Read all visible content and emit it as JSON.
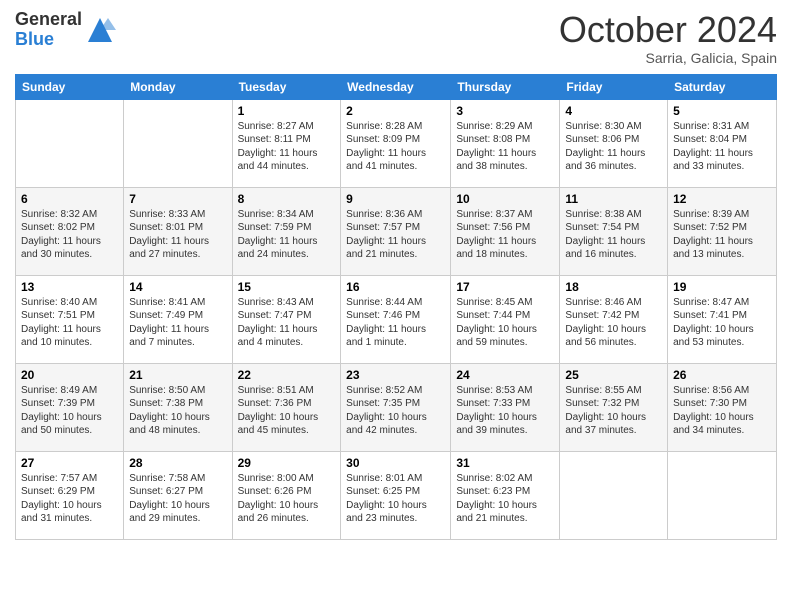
{
  "header": {
    "logo_general": "General",
    "logo_blue": "Blue",
    "month_title": "October 2024",
    "subtitle": "Sarria, Galicia, Spain"
  },
  "days_of_week": [
    "Sunday",
    "Monday",
    "Tuesday",
    "Wednesday",
    "Thursday",
    "Friday",
    "Saturday"
  ],
  "weeks": [
    [
      null,
      null,
      {
        "day": "1",
        "sunrise": "Sunrise: 8:27 AM",
        "sunset": "Sunset: 8:11 PM",
        "daylight": "Daylight: 11 hours and 44 minutes."
      },
      {
        "day": "2",
        "sunrise": "Sunrise: 8:28 AM",
        "sunset": "Sunset: 8:09 PM",
        "daylight": "Daylight: 11 hours and 41 minutes."
      },
      {
        "day": "3",
        "sunrise": "Sunrise: 8:29 AM",
        "sunset": "Sunset: 8:08 PM",
        "daylight": "Daylight: 11 hours and 38 minutes."
      },
      {
        "day": "4",
        "sunrise": "Sunrise: 8:30 AM",
        "sunset": "Sunset: 8:06 PM",
        "daylight": "Daylight: 11 hours and 36 minutes."
      },
      {
        "day": "5",
        "sunrise": "Sunrise: 8:31 AM",
        "sunset": "Sunset: 8:04 PM",
        "daylight": "Daylight: 11 hours and 33 minutes."
      }
    ],
    [
      {
        "day": "6",
        "sunrise": "Sunrise: 8:32 AM",
        "sunset": "Sunset: 8:02 PM",
        "daylight": "Daylight: 11 hours and 30 minutes."
      },
      {
        "day": "7",
        "sunrise": "Sunrise: 8:33 AM",
        "sunset": "Sunset: 8:01 PM",
        "daylight": "Daylight: 11 hours and 27 minutes."
      },
      {
        "day": "8",
        "sunrise": "Sunrise: 8:34 AM",
        "sunset": "Sunset: 7:59 PM",
        "daylight": "Daylight: 11 hours and 24 minutes."
      },
      {
        "day": "9",
        "sunrise": "Sunrise: 8:36 AM",
        "sunset": "Sunset: 7:57 PM",
        "daylight": "Daylight: 11 hours and 21 minutes."
      },
      {
        "day": "10",
        "sunrise": "Sunrise: 8:37 AM",
        "sunset": "Sunset: 7:56 PM",
        "daylight": "Daylight: 11 hours and 18 minutes."
      },
      {
        "day": "11",
        "sunrise": "Sunrise: 8:38 AM",
        "sunset": "Sunset: 7:54 PM",
        "daylight": "Daylight: 11 hours and 16 minutes."
      },
      {
        "day": "12",
        "sunrise": "Sunrise: 8:39 AM",
        "sunset": "Sunset: 7:52 PM",
        "daylight": "Daylight: 11 hours and 13 minutes."
      }
    ],
    [
      {
        "day": "13",
        "sunrise": "Sunrise: 8:40 AM",
        "sunset": "Sunset: 7:51 PM",
        "daylight": "Daylight: 11 hours and 10 minutes."
      },
      {
        "day": "14",
        "sunrise": "Sunrise: 8:41 AM",
        "sunset": "Sunset: 7:49 PM",
        "daylight": "Daylight: 11 hours and 7 minutes."
      },
      {
        "day": "15",
        "sunrise": "Sunrise: 8:43 AM",
        "sunset": "Sunset: 7:47 PM",
        "daylight": "Daylight: 11 hours and 4 minutes."
      },
      {
        "day": "16",
        "sunrise": "Sunrise: 8:44 AM",
        "sunset": "Sunset: 7:46 PM",
        "daylight": "Daylight: 11 hours and 1 minute."
      },
      {
        "day": "17",
        "sunrise": "Sunrise: 8:45 AM",
        "sunset": "Sunset: 7:44 PM",
        "daylight": "Daylight: 10 hours and 59 minutes."
      },
      {
        "day": "18",
        "sunrise": "Sunrise: 8:46 AM",
        "sunset": "Sunset: 7:42 PM",
        "daylight": "Daylight: 10 hours and 56 minutes."
      },
      {
        "day": "19",
        "sunrise": "Sunrise: 8:47 AM",
        "sunset": "Sunset: 7:41 PM",
        "daylight": "Daylight: 10 hours and 53 minutes."
      }
    ],
    [
      {
        "day": "20",
        "sunrise": "Sunrise: 8:49 AM",
        "sunset": "Sunset: 7:39 PM",
        "daylight": "Daylight: 10 hours and 50 minutes."
      },
      {
        "day": "21",
        "sunrise": "Sunrise: 8:50 AM",
        "sunset": "Sunset: 7:38 PM",
        "daylight": "Daylight: 10 hours and 48 minutes."
      },
      {
        "day": "22",
        "sunrise": "Sunrise: 8:51 AM",
        "sunset": "Sunset: 7:36 PM",
        "daylight": "Daylight: 10 hours and 45 minutes."
      },
      {
        "day": "23",
        "sunrise": "Sunrise: 8:52 AM",
        "sunset": "Sunset: 7:35 PM",
        "daylight": "Daylight: 10 hours and 42 minutes."
      },
      {
        "day": "24",
        "sunrise": "Sunrise: 8:53 AM",
        "sunset": "Sunset: 7:33 PM",
        "daylight": "Daylight: 10 hours and 39 minutes."
      },
      {
        "day": "25",
        "sunrise": "Sunrise: 8:55 AM",
        "sunset": "Sunset: 7:32 PM",
        "daylight": "Daylight: 10 hours and 37 minutes."
      },
      {
        "day": "26",
        "sunrise": "Sunrise: 8:56 AM",
        "sunset": "Sunset: 7:30 PM",
        "daylight": "Daylight: 10 hours and 34 minutes."
      }
    ],
    [
      {
        "day": "27",
        "sunrise": "Sunrise: 7:57 AM",
        "sunset": "Sunset: 6:29 PM",
        "daylight": "Daylight: 10 hours and 31 minutes."
      },
      {
        "day": "28",
        "sunrise": "Sunrise: 7:58 AM",
        "sunset": "Sunset: 6:27 PM",
        "daylight": "Daylight: 10 hours and 29 minutes."
      },
      {
        "day": "29",
        "sunrise": "Sunrise: 8:00 AM",
        "sunset": "Sunset: 6:26 PM",
        "daylight": "Daylight: 10 hours and 26 minutes."
      },
      {
        "day": "30",
        "sunrise": "Sunrise: 8:01 AM",
        "sunset": "Sunset: 6:25 PM",
        "daylight": "Daylight: 10 hours and 23 minutes."
      },
      {
        "day": "31",
        "sunrise": "Sunrise: 8:02 AM",
        "sunset": "Sunset: 6:23 PM",
        "daylight": "Daylight: 10 hours and 21 minutes."
      },
      null,
      null
    ]
  ]
}
